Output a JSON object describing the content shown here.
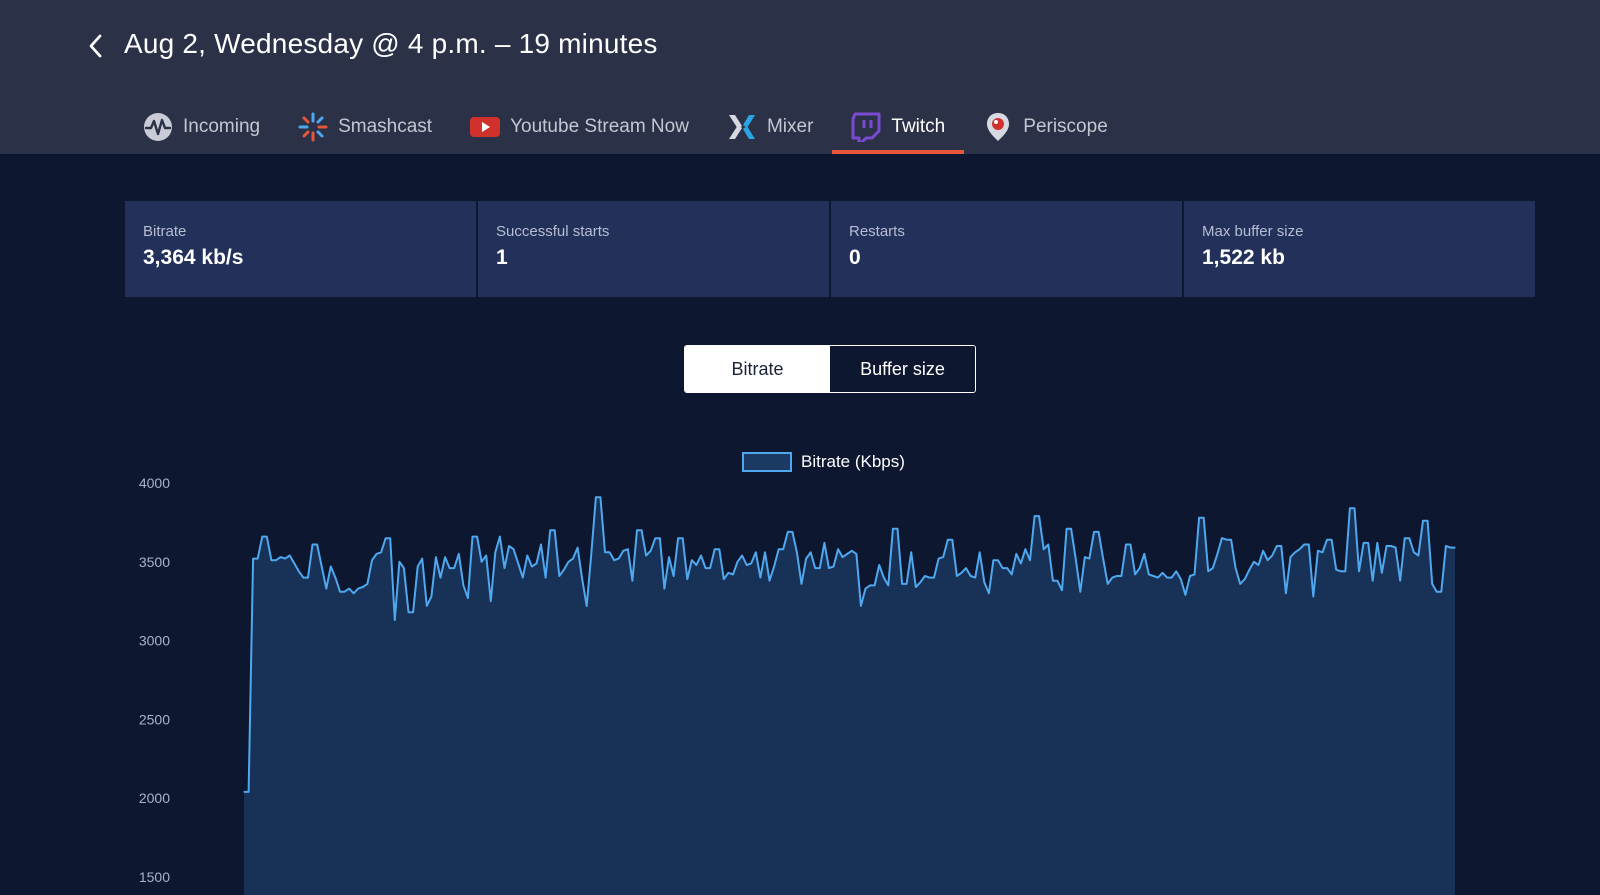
{
  "header": {
    "title": "Aug 2, Wednesday @ 4 p.m. – 19 minutes"
  },
  "tabs": [
    {
      "label": "Incoming",
      "icon": "pulse-icon",
      "active": false
    },
    {
      "label": "Smashcast",
      "icon": "smashcast-icon",
      "active": false
    },
    {
      "label": "Youtube Stream Now",
      "icon": "youtube-icon",
      "active": false
    },
    {
      "label": "Mixer",
      "icon": "mixer-icon",
      "active": false
    },
    {
      "label": "Twitch",
      "icon": "twitch-icon",
      "active": true
    },
    {
      "label": "Periscope",
      "icon": "periscope-icon",
      "active": false
    }
  ],
  "stats": [
    {
      "label": "Bitrate",
      "value": "3,364 kb/s"
    },
    {
      "label": "Successful starts",
      "value": "1"
    },
    {
      "label": "Restarts",
      "value": "0"
    },
    {
      "label": "Max buffer size",
      "value": "1,522 kb"
    }
  ],
  "toggle": {
    "bitrate_label": "Bitrate",
    "buffer_label": "Buffer size",
    "selected": "Bitrate"
  },
  "colors": {
    "header_bg": "#2b3146",
    "page_bg": "#0e1730",
    "card_bg": "#22305a",
    "accent": "#e6563a",
    "series_line": "#4fa8ef",
    "series_fill": "#183257",
    "twitch": "#6441a4",
    "youtube": "#d0312d"
  },
  "chart_data": {
    "type": "area",
    "legend": "Bitrate (Kbps)",
    "legend_position": "top-center",
    "yticks": [
      "4000",
      "3500",
      "3000",
      "2500",
      "2000",
      "1500"
    ],
    "ylim": [
      1500,
      4000
    ],
    "grid": false,
    "series": [
      {
        "name": "Bitrate (Kbps)",
        "values": [
          2040,
          2040,
          3520,
          3520,
          3660,
          3660,
          3510,
          3510,
          3530,
          3520,
          3540,
          3490,
          3440,
          3400,
          3400,
          3610,
          3610,
          3470,
          3330,
          3470,
          3400,
          3310,
          3310,
          3330,
          3300,
          3330,
          3340,
          3360,
          3510,
          3550,
          3560,
          3650,
          3650,
          3130,
          3500,
          3460,
          3180,
          3180,
          3470,
          3520,
          3220,
          3280,
          3530,
          3400,
          3530,
          3460,
          3460,
          3550,
          3350,
          3270,
          3660,
          3660,
          3500,
          3540,
          3250,
          3560,
          3660,
          3460,
          3600,
          3580,
          3490,
          3400,
          3540,
          3470,
          3490,
          3610,
          3400,
          3700,
          3700,
          3410,
          3450,
          3500,
          3520,
          3590,
          3390,
          3220,
          3550,
          3910,
          3910,
          3560,
          3560,
          3510,
          3520,
          3570,
          3580,
          3380,
          3700,
          3700,
          3540,
          3570,
          3650,
          3650,
          3330,
          3530,
          3410,
          3650,
          3650,
          3390,
          3510,
          3480,
          3540,
          3460,
          3460,
          3580,
          3580,
          3390,
          3430,
          3420,
          3500,
          3540,
          3480,
          3490,
          3560,
          3400,
          3560,
          3380,
          3470,
          3580,
          3580,
          3690,
          3690,
          3560,
          3360,
          3520,
          3560,
          3460,
          3460,
          3620,
          3460,
          3470,
          3580,
          3530,
          3550,
          3570,
          3550,
          3220,
          3330,
          3350,
          3350,
          3480,
          3400,
          3350,
          3710,
          3710,
          3360,
          3360,
          3560,
          3340,
          3370,
          3410,
          3400,
          3400,
          3520,
          3530,
          3640,
          3640,
          3410,
          3430,
          3460,
          3410,
          3400,
          3560,
          3370,
          3300,
          3510,
          3510,
          3460,
          3460,
          3420,
          3550,
          3490,
          3580,
          3510,
          3790,
          3790,
          3580,
          3610,
          3380,
          3380,
          3320,
          3710,
          3710,
          3520,
          3310,
          3530,
          3520,
          3690,
          3690,
          3520,
          3360,
          3400,
          3410,
          3410,
          3610,
          3610,
          3420,
          3460,
          3550,
          3420,
          3410,
          3400,
          3430,
          3400,
          3400,
          3440,
          3390,
          3290,
          3410,
          3420,
          3780,
          3780,
          3440,
          3460,
          3550,
          3650,
          3640,
          3640,
          3460,
          3360,
          3390,
          3450,
          3500,
          3480,
          3570,
          3510,
          3540,
          3600,
          3600,
          3300,
          3530,
          3560,
          3580,
          3610,
          3610,
          3280,
          3570,
          3560,
          3640,
          3640,
          3450,
          3440,
          3440,
          3840,
          3840,
          3440,
          3620,
          3620,
          3380,
          3620,
          3430,
          3600,
          3600,
          3590,
          3380,
          3650,
          3650,
          3560,
          3540,
          3760,
          3760,
          3360,
          3310,
          3310,
          3600,
          3590,
          3590
        ]
      }
    ]
  }
}
